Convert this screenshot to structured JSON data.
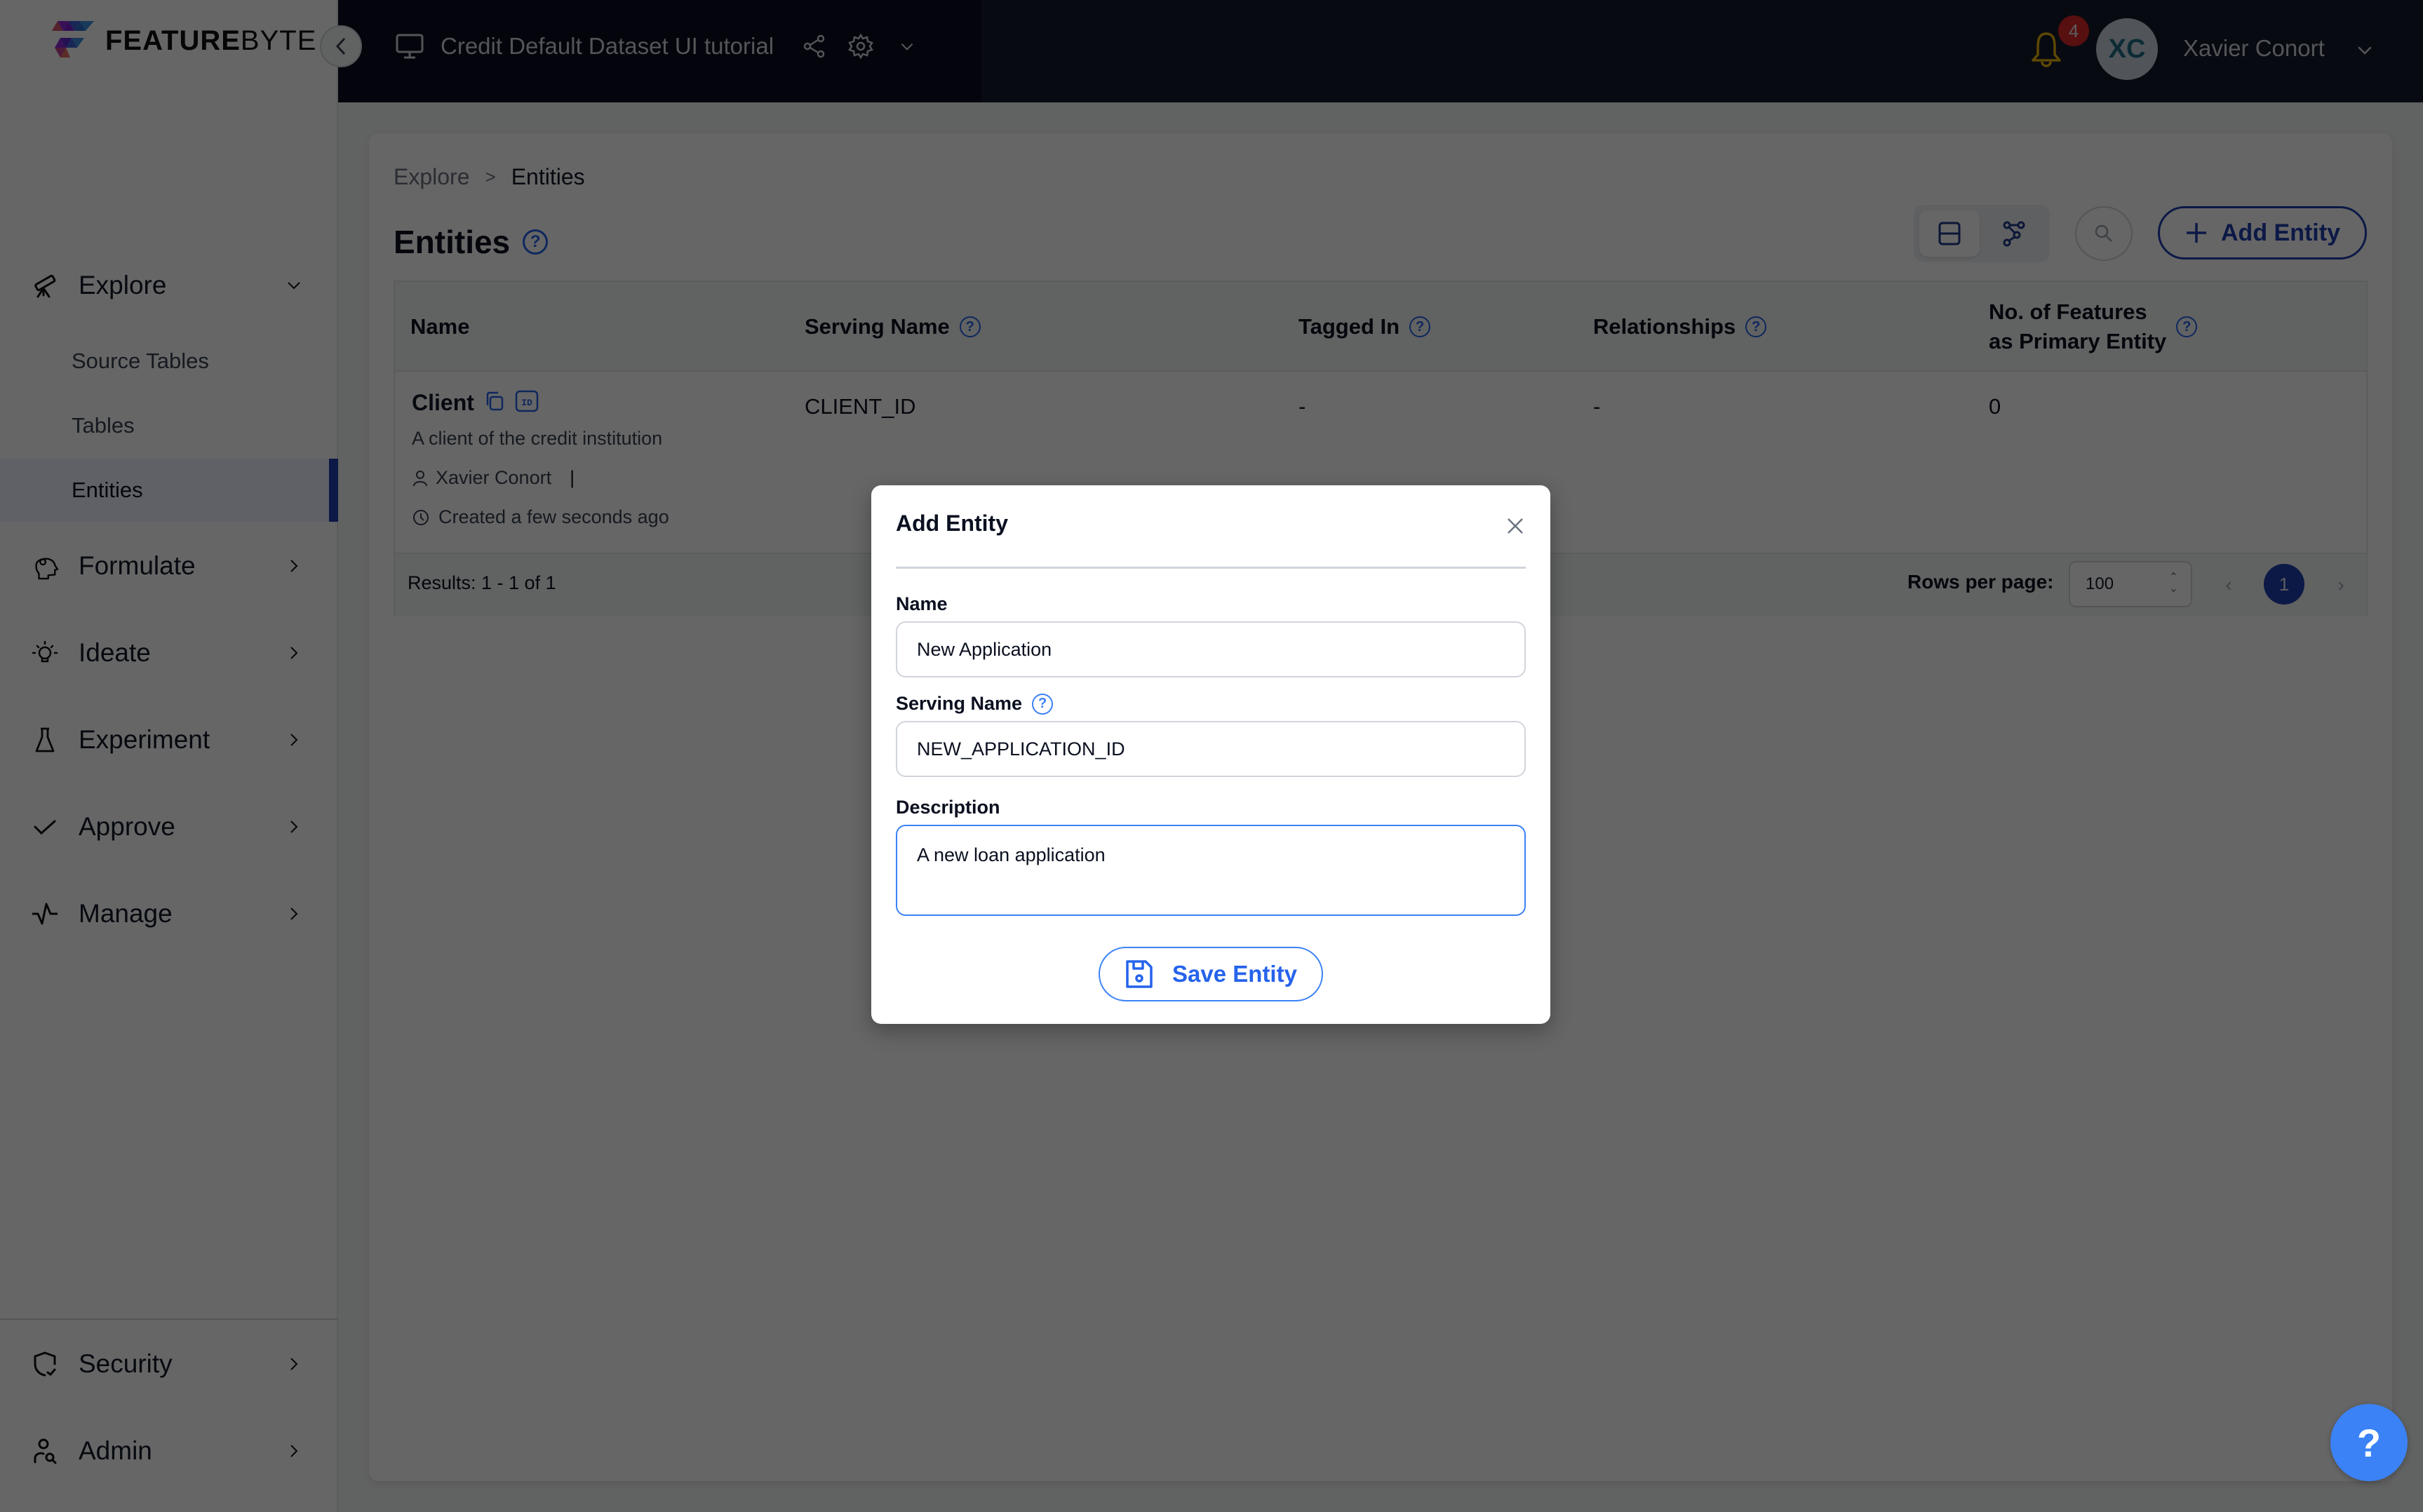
{
  "app": {
    "logo_bold": "FEATURE",
    "logo_light": "BYTE"
  },
  "topbar": {
    "project_title": "Credit Default Dataset UI tutorial",
    "notification_count": "4",
    "user_initials": "XC",
    "user_name": "Xavier Conort"
  },
  "sidebar": {
    "sections": [
      {
        "label": "Explore",
        "icon": "telescope-icon",
        "expanded": true
      },
      {
        "label": "Formulate",
        "icon": "head-gear-icon"
      },
      {
        "label": "Ideate",
        "icon": "lightbulb-icon"
      },
      {
        "label": "Experiment",
        "icon": "flask-icon"
      },
      {
        "label": "Approve",
        "icon": "check-icon"
      },
      {
        "label": "Manage",
        "icon": "pulse-icon"
      },
      {
        "label": "Security",
        "icon": "shield-check-icon"
      },
      {
        "label": "Admin",
        "icon": "user-search-icon"
      }
    ],
    "explore_items": [
      {
        "label": "Source Tables"
      },
      {
        "label": "Tables"
      },
      {
        "label": "Entities",
        "active": true
      }
    ]
  },
  "main": {
    "breadcrumb": [
      {
        "label": "Explore"
      },
      {
        "label": ">"
      },
      {
        "label": "Entities"
      }
    ],
    "title": "Entities",
    "add_button_label": "Add Entity",
    "table": {
      "columns": [
        {
          "label": "Name",
          "help": false
        },
        {
          "label": "Serving Name",
          "help": true
        },
        {
          "label": "Tagged In",
          "help": true
        },
        {
          "label": "Relationships",
          "help": true
        },
        {
          "label_line1": "No. of Features",
          "label_line2": "as Primary Entity",
          "help": true
        }
      ],
      "rows": [
        {
          "name": "Client",
          "description": "A client of the credit institution",
          "owner": "Xavier Conort",
          "created": "Created a few seconds ago",
          "serving_name": "CLIENT_ID",
          "tagged_in": "-",
          "relationships": "-",
          "num_features": "0"
        }
      ],
      "results_text": "Results: 1 - 1 of 1",
      "rows_per_page_label": "Rows per page:",
      "rows_per_page_value": "100",
      "current_page": "1"
    }
  },
  "modal": {
    "title": "Add Entity",
    "name_label": "Name",
    "name_value": "New Application",
    "serving_name_label": "Serving Name",
    "serving_name_value": "NEW_APPLICATION_ID",
    "description_label": "Description",
    "description_value": "A new loan application",
    "save_label": "Save Entity"
  },
  "help_fab": "?",
  "colors": {
    "accent": "#1e40af",
    "modal_accent": "#3b82f6",
    "topbar": "#0b0e1f",
    "badge": "#dc2626"
  }
}
